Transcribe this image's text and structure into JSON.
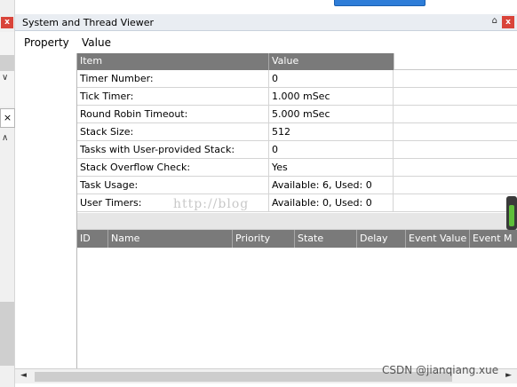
{
  "window": {
    "title": "System and Thread Viewer",
    "pin_glyph": "⌂",
    "close_glyph": "x"
  },
  "left_strip": {
    "close_glyph": "x",
    "chevron_down": "∨",
    "tab_close": "×",
    "chevron_up": "∧"
  },
  "columns_header": {
    "property": "Property",
    "value": "Value"
  },
  "system_grid": {
    "headers": [
      "Item",
      "Value"
    ],
    "rows": [
      {
        "item": "Timer Number:",
        "value": "0"
      },
      {
        "item": "Tick Timer:",
        "value": "1.000 mSec"
      },
      {
        "item": "Round Robin Timeout:",
        "value": "5.000 mSec"
      },
      {
        "item": "Stack Size:",
        "value": "512"
      },
      {
        "item": "Tasks with User-provided Stack:",
        "value": "0"
      },
      {
        "item": "Stack Overflow Check:",
        "value": "Yes"
      },
      {
        "item": "Task Usage:",
        "value": "Available: 6, Used: 0"
      },
      {
        "item": "User Timers:",
        "value": "Available: 0, Used: 0"
      }
    ]
  },
  "task_grid": {
    "headers": [
      "ID",
      "Name",
      "Priority",
      "State",
      "Delay",
      "Event Value",
      "Event M"
    ]
  },
  "scrollbar": {
    "left_arrow": "◄",
    "right_arrow": "►"
  },
  "watermark": "http://blog",
  "csdn_label": "CSDN @jianqiang.xue",
  "colors": {
    "header_gray": "#7a7a7a",
    "close_red": "#d9443a",
    "title_bar": "#e9edf2",
    "level_green": "#5fbf3a"
  }
}
